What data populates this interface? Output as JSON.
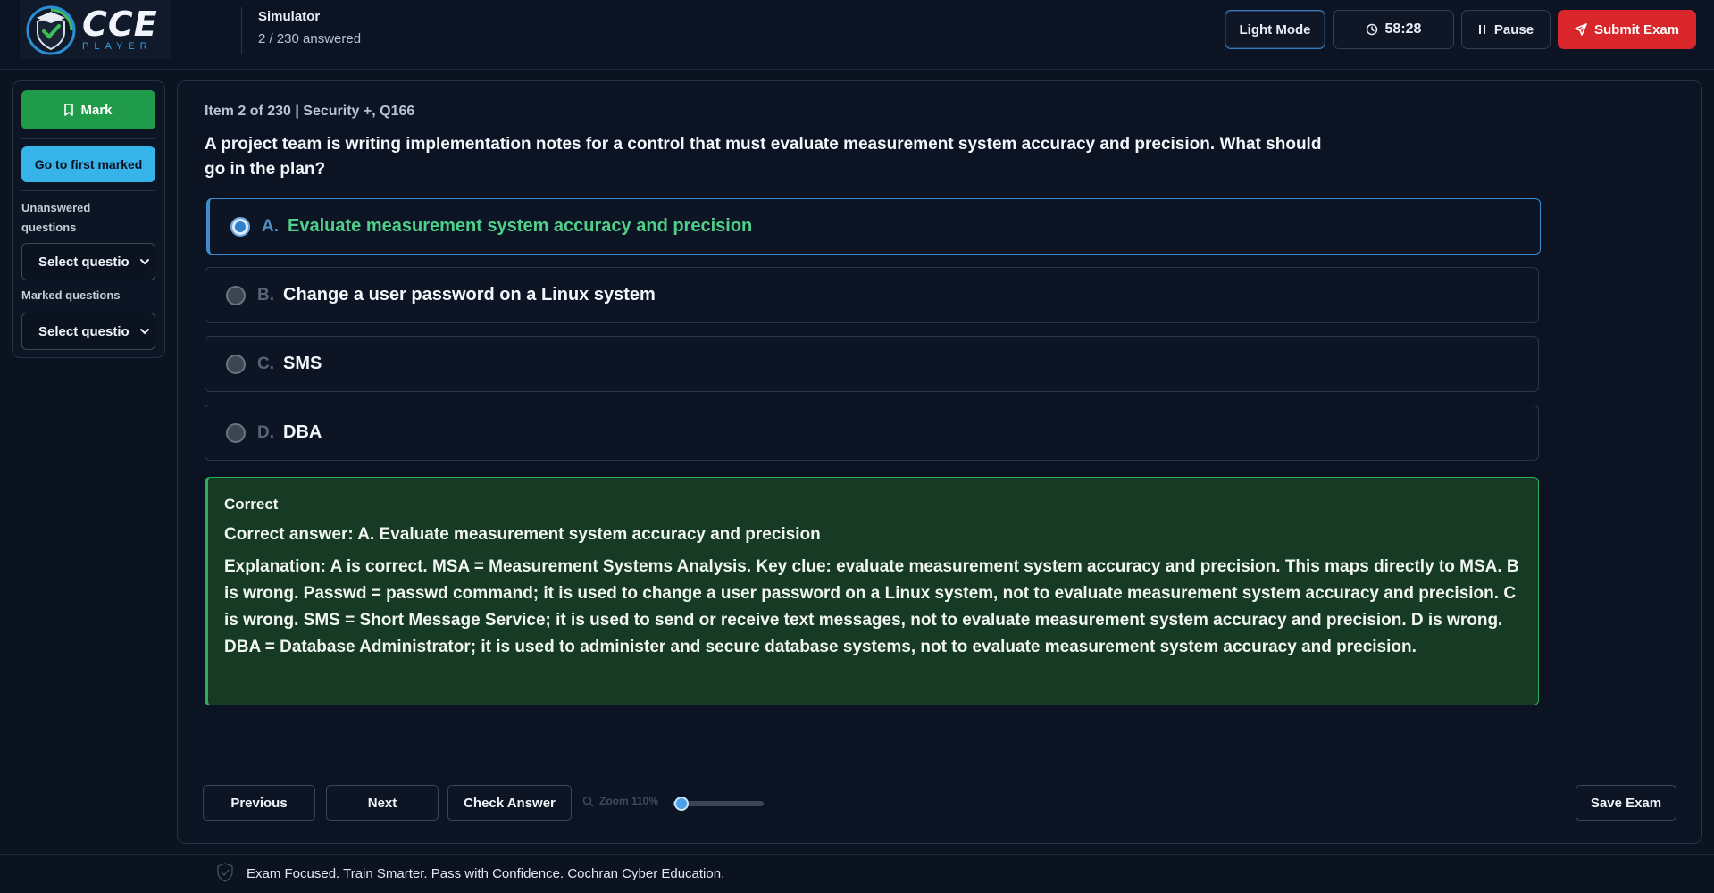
{
  "header": {
    "logo_text": "CCE",
    "logo_subtext": "PLAYER",
    "title": "Simulator",
    "progress": "2 / 230 answered",
    "light_mode_label": "Light Mode",
    "timer": "58:28",
    "pause_label": "Pause",
    "submit_label": "Submit Exam"
  },
  "sidebar": {
    "mark_label": "Mark",
    "first_marked_label": "Go to first marked",
    "unanswered_label_line1": "Unanswered",
    "unanswered_label_line2": "questions",
    "unanswered_select": "Select questio",
    "marked_label": "Marked questions",
    "marked_select": "Select questio"
  },
  "question": {
    "meta": "Item 2 of 230 | Security +, Q166",
    "text": "A project team is writing implementation notes for a control that must evaluate measurement system accuracy and precision. What should go in the plan?",
    "options": [
      {
        "letter": "A.",
        "text": "Evaluate measurement system accuracy and precision",
        "selected": true
      },
      {
        "letter": "B.",
        "text": "Change a user password on a Linux system",
        "selected": false
      },
      {
        "letter": "C.",
        "text": "SMS",
        "selected": false
      },
      {
        "letter": "D.",
        "text": "DBA",
        "selected": false
      }
    ]
  },
  "feedback": {
    "status": "Correct",
    "answer": "Correct answer: A. Evaluate measurement system accuracy and precision",
    "explanation": "Explanation: A is correct. MSA = Measurement Systems Analysis. Key clue: evaluate measurement system accuracy and precision. This maps directly to MSA. B is wrong. Passwd = passwd command; it is used to change a user password on a Linux system, not to evaluate measurement system accuracy and precision. C is wrong. SMS = Short Message Service; it is used to send or receive text messages, not to evaluate measurement system accuracy and precision. D is wrong. DBA = Database Administrator; it is used to administer and secure database systems, not to evaluate measurement system accuracy and precision."
  },
  "footer": {
    "previous_label": "Previous",
    "next_label": "Next",
    "check_label": "Check Answer",
    "zoom_label": "Zoom 110%",
    "zoom_fraction": 0.1,
    "save_label": "Save Exam"
  },
  "bottombar": {
    "tagline": "Exam Focused. Train Smarter. Pass with Confidence. Cochran Cyber Education."
  },
  "colors": {
    "accent_blue": "#2f7fcd",
    "submit_red": "#d9262b",
    "mark_green": "#1f9b4a",
    "correct_green": "#2eae5b"
  }
}
